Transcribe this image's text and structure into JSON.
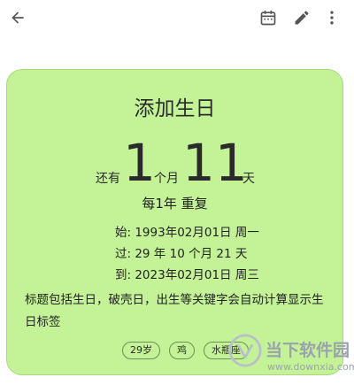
{
  "header": {
    "back_icon": "arrow-left-icon",
    "calendar_icon": "calendar-icon",
    "edit_icon": "pencil-icon",
    "more_icon": "more-vertical-icon"
  },
  "card": {
    "background": "#c4f297",
    "title": "添加生日",
    "countdown": {
      "prefix": "还有",
      "months": "1",
      "month_unit": "个月",
      "days": "11",
      "day_unit": "天"
    },
    "repeat": "每1年 重复",
    "info": {
      "start": "始:  1993年02月01日 周一",
      "passed": "过:  29 年 10 个月 21 天",
      "arrive": "到:  2023年02月01日 周三"
    },
    "note": "标题包括生日，破壳日，出生等关键字会自动计算显示生日标签",
    "tags": [
      "29岁",
      "鸡",
      "水瓶座"
    ]
  },
  "watermark": {
    "title": "当下软件园",
    "url": "www.downxia.com"
  }
}
